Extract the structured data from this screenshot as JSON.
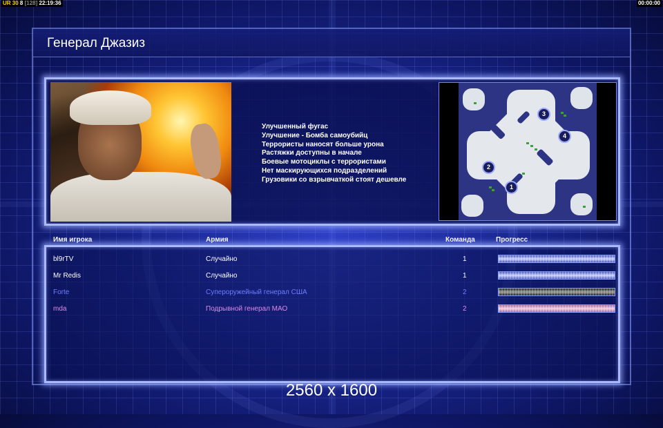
{
  "top_bar": {
    "stats_prefix": "UR 30",
    "stats_num": "8",
    "stats_bracket": "[128]",
    "time": "22:19:36",
    "timer": "00:00:00"
  },
  "loading_screen": {
    "general_name": "Генерал Джазиз",
    "bonuses": [
      "Улучшенный фугас",
      "Улучшение - Бомба самоубийц",
      "Террористы наносят больше урона",
      "Растяжки доступны в начале",
      "Боевые мотоциклы с террористами",
      "Нет маскирующихся подразделений",
      "Грузовики со взрывчаткой стоят дешевле"
    ],
    "map_markers": [
      "1",
      "2",
      "3",
      "4"
    ]
  },
  "players_table": {
    "headers": {
      "player": "Имя игрока",
      "army": "Армия",
      "team": "Команда",
      "progress": "Прогресс"
    },
    "rows": [
      {
        "name": "bl9rTV",
        "army": "Случайно",
        "team": "1",
        "progress": 1.0,
        "color": "#ffffff"
      },
      {
        "name": "Mr Redis",
        "army": "Случайно",
        "team": "1",
        "progress": 1.0,
        "color": "#ffffff"
      },
      {
        "name": "Forte",
        "army": "Супероружейный генерал США",
        "team": "2",
        "progress": 1.0,
        "color": "#6f7dff"
      },
      {
        "name": "mda",
        "army": "Подрывной генерал МАО",
        "team": "2",
        "progress": 1.0,
        "color": "#e08ae6"
      }
    ]
  },
  "footer": {
    "resolution": "2560 x 1600"
  }
}
